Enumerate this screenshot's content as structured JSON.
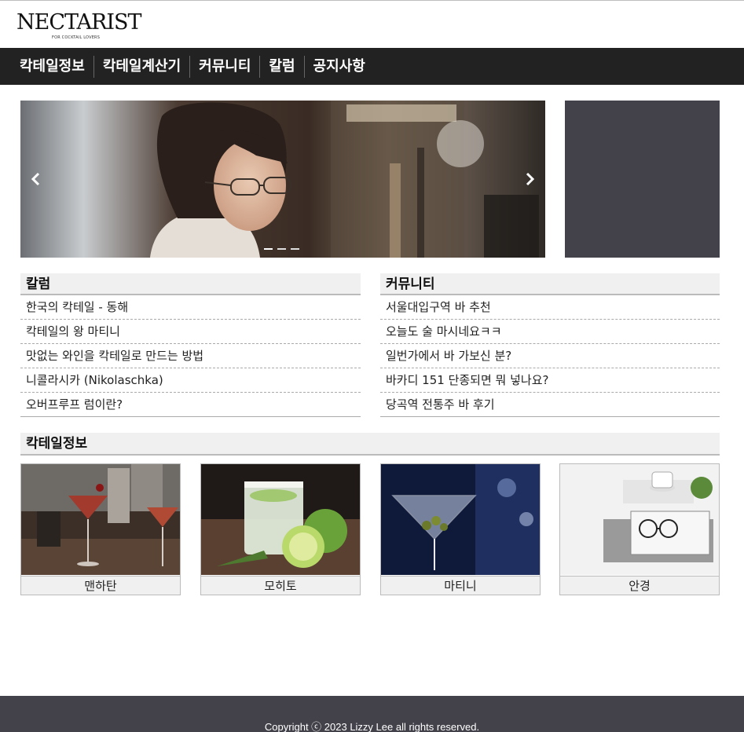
{
  "header": {
    "logo_text": "NECTARIST",
    "logo_tagline": "FOR COCKTAIL LOVERS"
  },
  "nav": {
    "items": [
      {
        "label": "칵테일정보"
      },
      {
        "label": "칵테일계산기"
      },
      {
        "label": "커뮤니티"
      },
      {
        "label": "칼럼"
      },
      {
        "label": "공지사항"
      }
    ]
  },
  "slider": {
    "prev_icon": "chevron-left-icon",
    "next_icon": "chevron-right-icon",
    "slide_count": 3,
    "active_index": 0
  },
  "column": {
    "title": "칼럼",
    "items": [
      {
        "label": "한국의 칵테일 - 동해"
      },
      {
        "label": "칵테일의 왕 마티니"
      },
      {
        "label": "맛없는 와인을 칵테일로 만드는 방법"
      },
      {
        "label": "니콜라시카 (Nikolaschka)"
      },
      {
        "label": "오버프루프 럼이란?"
      }
    ]
  },
  "community": {
    "title": "커뮤니티",
    "items": [
      {
        "label": "서울대입구역 바 추천"
      },
      {
        "label": "오늘도 술 마시네요ㅋㅋ"
      },
      {
        "label": "일번가에서 바 가보신 분?"
      },
      {
        "label": "바카디 151 단종되면 뭐 넣나요?"
      },
      {
        "label": "당곡역 전통주 바 후기"
      }
    ]
  },
  "cocktail_info": {
    "title": "칵테일정보",
    "cards": [
      {
        "label": "맨하탄"
      },
      {
        "label": "모히토"
      },
      {
        "label": "마티니"
      },
      {
        "label": "안경"
      }
    ]
  },
  "footer": {
    "copyright": "Copyright ⓒ 2023 Lizzy Lee all rights reserved."
  },
  "colors": {
    "nav_bg": "#222222",
    "side_banner": "#434149",
    "footer_bg": "#434149",
    "section_header_bg": "#f0f0f0"
  }
}
